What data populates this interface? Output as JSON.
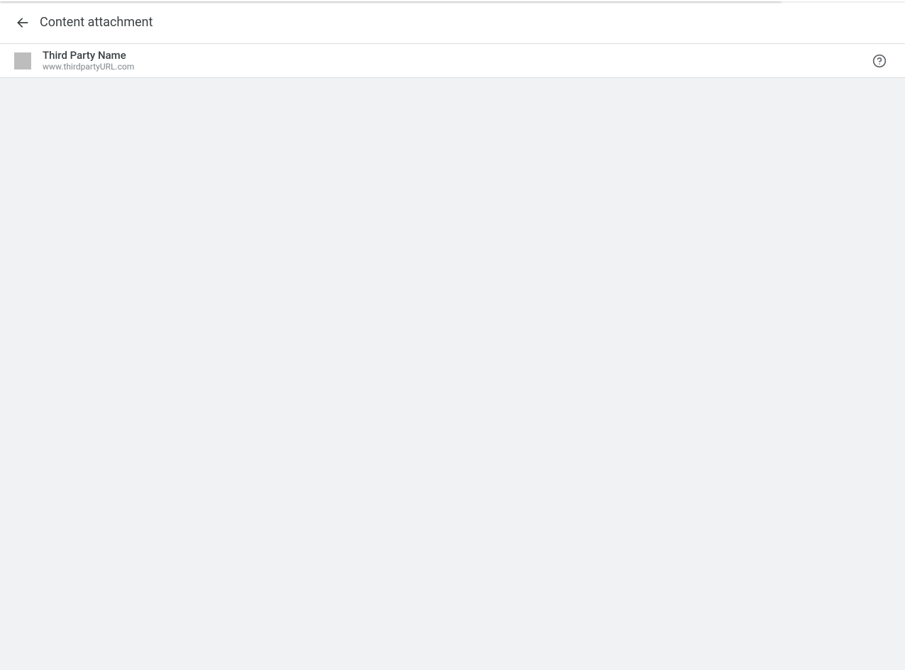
{
  "header": {
    "title": "Content attachment"
  },
  "provider": {
    "name": "Third Party Name",
    "url": "www.thirdpartyURL.com"
  }
}
